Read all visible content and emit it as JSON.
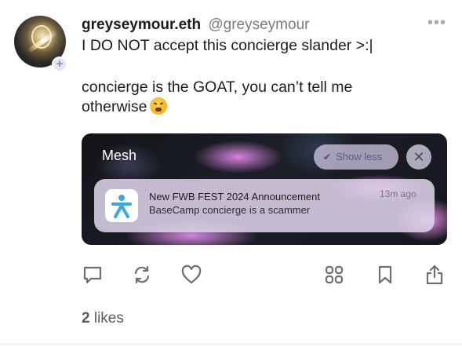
{
  "post": {
    "display_name": "greyseymour.eth",
    "handle": "@greyseymour",
    "more_label": "•••",
    "line1": "I DO NOT accept this concierge slander >:|",
    "line2": "concierge is the GOAT, you can’t tell me",
    "line3": "otherwise",
    "emoji": "face-with-steam-from-nose"
  },
  "media": {
    "label": "Mesh",
    "show_less_label": "Show less",
    "close_label": "✕",
    "notification": {
      "title": "New FWB FEST 2024 Announcement",
      "body": "BaseCamp concierge is a scammer",
      "time": "13m ago",
      "icon": "person-icon"
    }
  },
  "actions": {
    "icons": [
      "reply-icon",
      "recast-icon",
      "like-icon",
      "apps-icon",
      "bookmark-icon",
      "share-icon"
    ]
  },
  "likes": {
    "count": "2",
    "label": "likes"
  },
  "colors": {
    "accent_purple": "#8e86b8",
    "icon_gray": "#6e6e73",
    "text": "#1c1c1e"
  }
}
